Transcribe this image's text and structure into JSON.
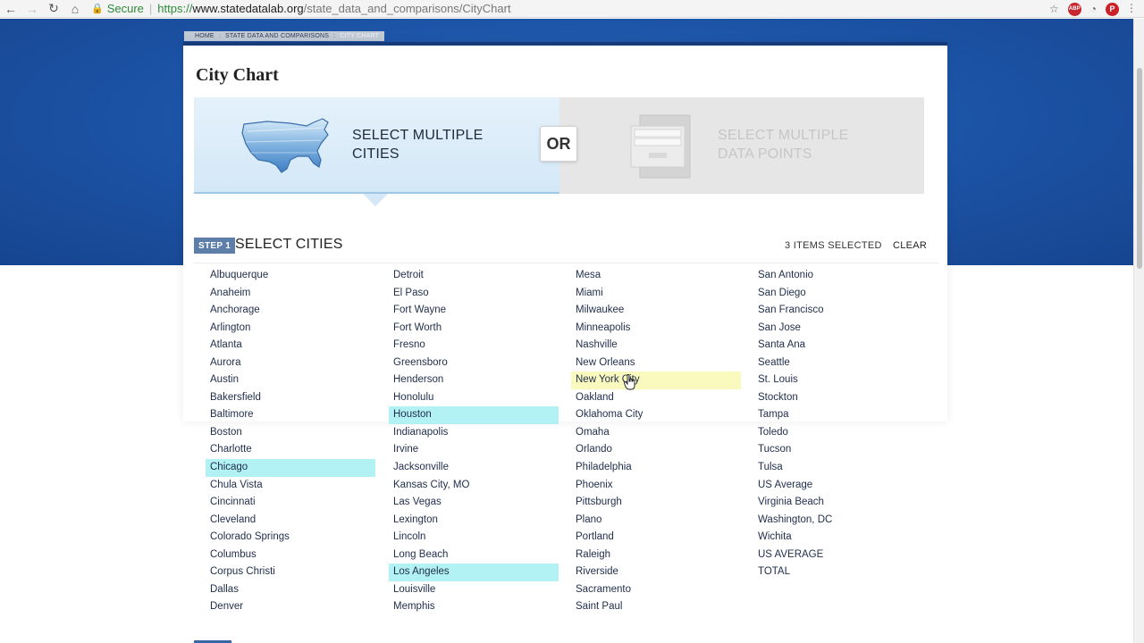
{
  "browser": {
    "back_icon": "back-arrow-icon",
    "forward_icon": "forward-arrow-icon",
    "reload_icon": "reload-icon",
    "home_icon": "home-icon",
    "secure_label": "Secure",
    "url_scheme": "https://",
    "url_host": "www.statedatalab.org",
    "url_path": "/state_data_and_comparisons/CityChart",
    "ext_abp": "ABP",
    "ext_pin": "P"
  },
  "breadcrumb": {
    "home": "HOME",
    "section": "STATE DATA AND COMPARISONS",
    "current": "CITY CHART"
  },
  "page": {
    "title": "City Chart"
  },
  "choices": {
    "cities_label": "SELECT MULTIPLE CITIES",
    "or_label": "OR",
    "datapoints_label": "SELECT MULTIPLE DATA POINTS"
  },
  "step": {
    "badge": "STEP 1",
    "title": "SELECT CITIES",
    "items_selected": "3 ITEMS SELECTED",
    "clear": "CLEAR"
  },
  "colors": {
    "selected": "#b2f1f4",
    "hovered": "#fafabf",
    "brand_blue": "#1d55a8"
  },
  "cities": {
    "col1": [
      "Albuquerque",
      "Anaheim",
      "Anchorage",
      "Arlington",
      "Atlanta",
      "Aurora",
      "Austin",
      "Bakersfield",
      "Baltimore",
      "Boston",
      "Charlotte",
      "Chicago",
      "Chula Vista",
      "Cincinnati",
      "Cleveland",
      "Colorado Springs",
      "Columbus",
      "Corpus Christi",
      "Dallas",
      "Denver"
    ],
    "col2": [
      "Detroit",
      "El Paso",
      "Fort Wayne",
      "Fort Worth",
      "Fresno",
      "Greensboro",
      "Henderson",
      "Honolulu",
      "Houston",
      "Indianapolis",
      "Irvine",
      "Jacksonville",
      "Kansas City, MO",
      "Las Vegas",
      "Lexington",
      "Lincoln",
      "Long Beach",
      "Los Angeles",
      "Louisville",
      "Memphis"
    ],
    "col3": [
      "Mesa",
      "Miami",
      "Milwaukee",
      "Minneapolis",
      "Nashville",
      "New Orleans",
      "New York City",
      "Oakland",
      "Oklahoma City",
      "Omaha",
      "Orlando",
      "Philadelphia",
      "Phoenix",
      "Pittsburgh",
      "Plano",
      "Portland",
      "Raleigh",
      "Riverside",
      "Sacramento",
      "Saint Paul"
    ],
    "col4": [
      "San Antonio",
      "San Diego",
      "San Francisco",
      "San Jose",
      "Santa Ana",
      "Seattle",
      "St. Louis",
      "Stockton",
      "Tampa",
      "Toledo",
      "Tucson",
      "Tulsa",
      "US Average",
      "Virginia Beach",
      "Washington, DC",
      "Wichita",
      "US AVERAGE",
      "TOTAL"
    ],
    "selected": [
      "Chicago",
      "Houston",
      "Los Angeles"
    ],
    "hovered": "New York City"
  }
}
